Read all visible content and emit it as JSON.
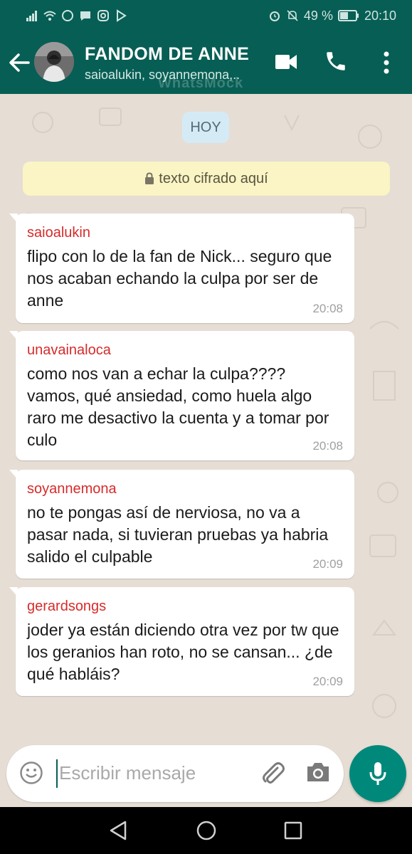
{
  "status_bar": {
    "battery_percent": "49 %",
    "time": "20:10"
  },
  "header": {
    "title": "FANDOM DE ANNE",
    "subtitle": "saioalukin, soyannemona,..",
    "watermark": "WhatsMock",
    "icons": [
      "back-arrow-icon",
      "video-call-icon",
      "phone-icon",
      "more-options-icon"
    ]
  },
  "chat": {
    "day_label": "HOY",
    "encryption_notice": "texto cifrado aquí",
    "messages": [
      {
        "sender": "saioalukin",
        "text": "flipo con lo de la fan de Nick... seguro que nos acaban echando la culpa por ser de anne",
        "time": "20:08"
      },
      {
        "sender": "unavainaloca",
        "text": "como nos van a echar la culpa???? vamos, qué ansiedad, como huela algo raro me desactivo la cuenta y a tomar por culo",
        "time": "20:08"
      },
      {
        "sender": "soyannemona",
        "text": "no te pongas así de nerviosa, no va a pasar nada, si tuvieran pruebas ya habria salido el culpable",
        "time": "20:09"
      },
      {
        "sender": "gerardsongs",
        "text": "joder ya están diciendo otra vez por tw que los geranios han roto, no se cansan... ¿de qué habláis?",
        "time": "20:09"
      }
    ]
  },
  "composer": {
    "placeholder": "Escribir mensaje",
    "icons": [
      "emoji-icon",
      "attach-icon",
      "camera-icon",
      "mic-icon"
    ]
  },
  "colors": {
    "header": "#075e54",
    "accent": "#00897b",
    "sender_name": "#d62b2b",
    "chat_bg": "#e6ddd4"
  }
}
